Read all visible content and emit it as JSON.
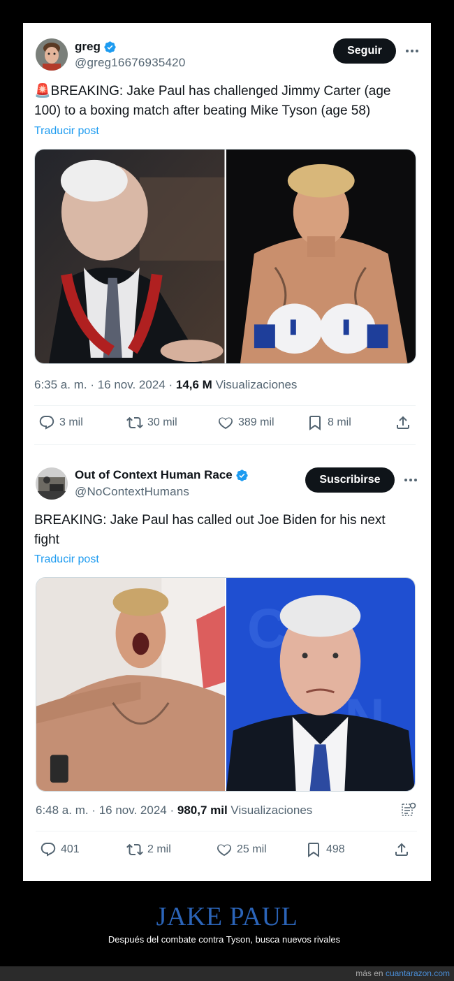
{
  "tweet1": {
    "name": "greg",
    "handle": "@greg16676935420",
    "follow_label": "Seguir",
    "text": "🚨BREAKING: Jake Paul has challenged Jimmy Carter (age 100) to a boxing match after beating Mike Tyson (age 58)",
    "translate": "Traducir post",
    "time": "6:35 a. m. · 16 nov. 2024 · ",
    "views_count": "14,6 M",
    "views_label": " Visualizaciones",
    "replies": "3 mil",
    "retweets": "30 mil",
    "likes": "389 mil",
    "bookmarks": "8 mil"
  },
  "tweet2": {
    "name": "Out of Context Human Race",
    "handle": "@NoContextHumans",
    "follow_label": "Suscribirse",
    "text": "BREAKING: Jake Paul has called out Joe Biden for his next fight",
    "translate": "Traducir post",
    "time": "6:48 a. m. · 16 nov. 2024 · ",
    "views_count": "980,7 mil",
    "views_label": " Visualizaciones",
    "replies": "401",
    "retweets": "2 mil",
    "likes": "25 mil",
    "bookmarks": "498"
  },
  "caption": {
    "title": "JAKE PAUL",
    "subtitle": "Después del combate contra Tyson, busca nuevos rivales"
  },
  "footer": {
    "prefix": "más en ",
    "site": "cuantarazon.com"
  },
  "icons": {
    "reply": "reply-icon",
    "retweet": "retweet-icon",
    "like": "heart-icon",
    "bookmark": "bookmark-icon",
    "share": "share-icon",
    "verified": "verified-badge-icon",
    "more": "more-icon",
    "grok": "grok-icon"
  },
  "colors": {
    "link": "#1d9bf0",
    "verified": "#1d9bf0",
    "caption_title": "#2b64b8"
  }
}
